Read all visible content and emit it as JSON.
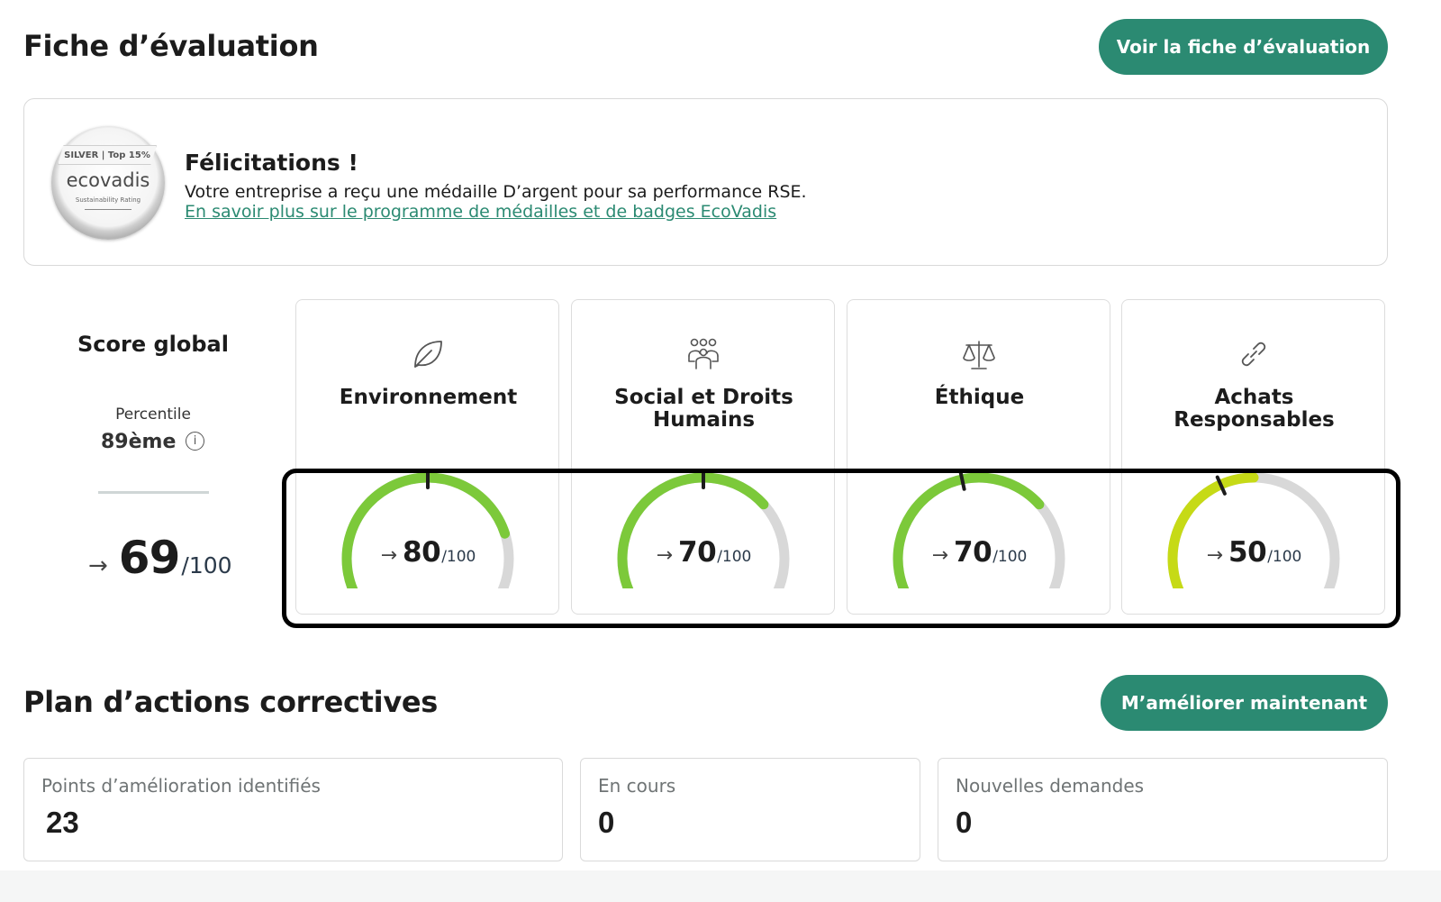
{
  "evaluation": {
    "title": "Fiche d’évaluation",
    "view_button": "Voir la fiche d’évaluation",
    "congrats": {
      "medal_band": "SILVER | Top 15%",
      "medal_logo": "ecovadis",
      "medal_sub": "Sustainability Rating",
      "title": "Félicitations !",
      "text": "Votre entreprise a reçu une médaille D’argent pour sa performance RSE.",
      "link": "En savoir plus sur le programme de médailles et de badges EcoVadis"
    },
    "score": {
      "title": "Score global",
      "percentile_label": "Percentile",
      "percentile_value": "89ème",
      "info_icon": "i",
      "arrow": "→",
      "value": "69",
      "max": "/100"
    },
    "themes": [
      {
        "name": "Environnement",
        "icon": "leaf-icon",
        "arrow": "→",
        "value": "80",
        "max": "/100",
        "score": 80,
        "color": "#7cc93a"
      },
      {
        "name": "Social et Droits Humains",
        "icon": "people-icon",
        "arrow": "→",
        "value": "70",
        "max": "/100",
        "score": 70,
        "color": "#7cc93a"
      },
      {
        "name": "Éthique",
        "icon": "scale-icon",
        "arrow": "→",
        "value": "70",
        "max": "/100",
        "score": 70,
        "color": "#7cc93a"
      },
      {
        "name": "Achats Responsables",
        "icon": "link-icon",
        "arrow": "→",
        "value": "50",
        "max": "/100",
        "score": 50,
        "color": "#c6da16"
      }
    ],
    "marker_scores": [
      50,
      50,
      45,
      40
    ]
  },
  "plan": {
    "title": "Plan d’actions correctives",
    "button": "M’améliorer maintenant",
    "stats": [
      {
        "label": "Points d’amélioration identifiés",
        "value": "23"
      },
      {
        "label": "En cours",
        "value": "0"
      },
      {
        "label": "Nouvelles demandes",
        "value": "0"
      }
    ]
  },
  "colors": {
    "brand": "#2b8a72",
    "gauge_track": "#d8d8d8",
    "gauge_green": "#7cc93a",
    "gauge_yellow": "#c6da16"
  }
}
